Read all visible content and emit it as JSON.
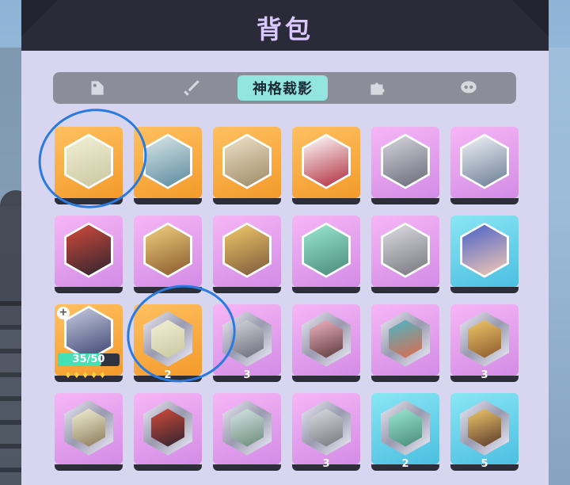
{
  "header": {
    "title": "背包"
  },
  "tabs": [
    {
      "id": "t1",
      "label": "",
      "icon": "tag-icon"
    },
    {
      "id": "t2",
      "label": "",
      "icon": "sword-icon"
    },
    {
      "id": "t3",
      "label": "神格裁影",
      "icon": ""
    },
    {
      "id": "t4",
      "label": "",
      "icon": "puzzle-icon"
    },
    {
      "id": "t5",
      "label": "",
      "icon": "chat-icon"
    }
  ],
  "active_tab": "神格裁影",
  "special_item": {
    "progress_text": "35/50",
    "progress": 0.7,
    "stars": "♦♦♦♦♦"
  },
  "counts": {
    "r3c2": "2",
    "r3c3": "3",
    "r3c6": "3",
    "r4c4": "3",
    "r4c5": "2",
    "r4c6": "5"
  },
  "colors": {
    "accent_tab": "#93e6df",
    "orange_card": "#f39a2a",
    "pink_card": "#d38ce6",
    "blue_card": "#4bbfe1",
    "annotation": "#2a7be0"
  }
}
